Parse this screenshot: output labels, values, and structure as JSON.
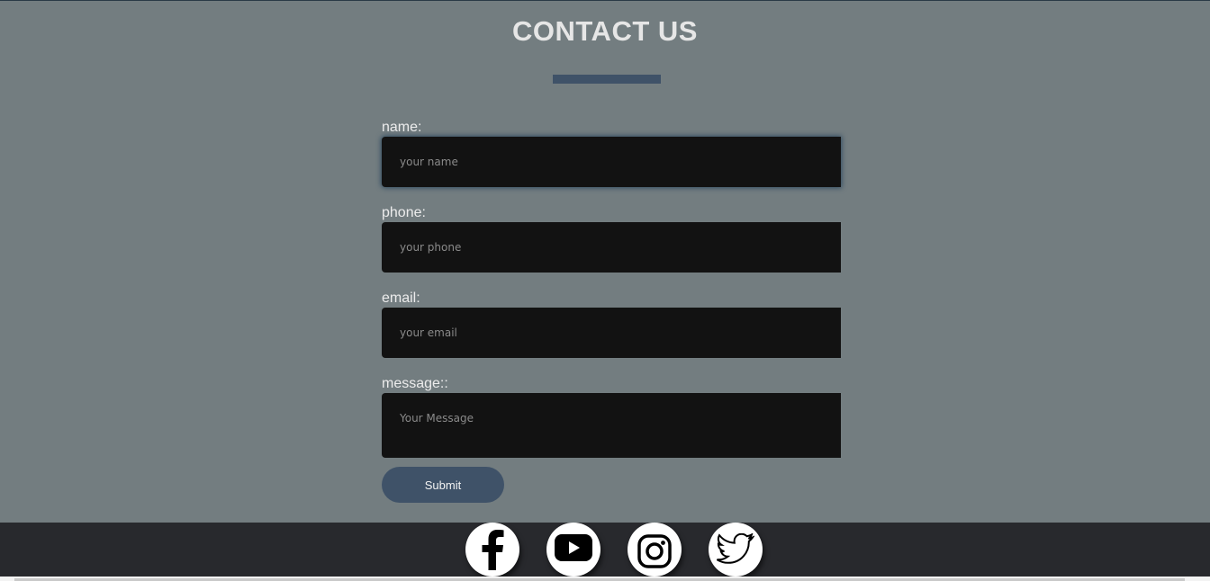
{
  "page": {
    "title": "CONTACT US"
  },
  "form": {
    "name": {
      "label": "name:",
      "placeholder": "your name"
    },
    "phone": {
      "label": "phone:",
      "placeholder": "your phone"
    },
    "email": {
      "label": "email:",
      "placeholder": "your email"
    },
    "message": {
      "label": "message::",
      "placeholder": "Your Message"
    },
    "submit_label": "Submit"
  },
  "footer": {
    "social": [
      {
        "icon": "facebook-icon"
      },
      {
        "icon": "youtube-icon"
      },
      {
        "icon": "instagram-icon"
      },
      {
        "icon": "twitter-icon"
      }
    ]
  },
  "colors": {
    "background": "#737d80",
    "accent": "#3f5268",
    "field_bg": "#121212",
    "footer_bg": "#28292d"
  }
}
